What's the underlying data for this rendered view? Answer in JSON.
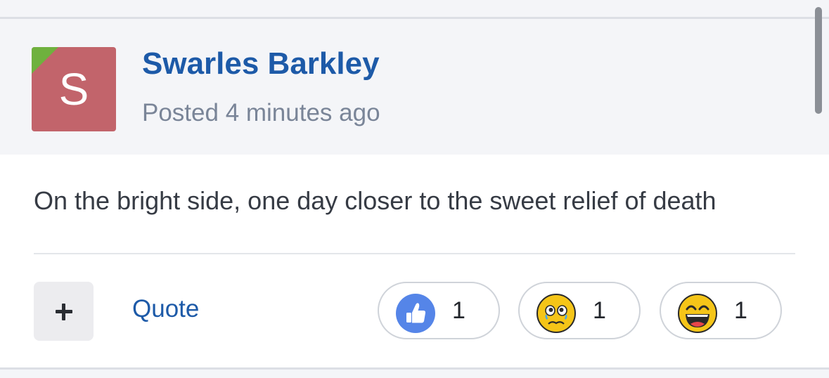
{
  "post": {
    "author_name": "Swarles Barkley",
    "avatar_letter": "S",
    "posted_time": "Posted 4 minutes ago",
    "body": "On the bright side, one day closer to the sweet relief of death"
  },
  "actions": {
    "add_icon": "plus-icon",
    "quote_label": "Quote"
  },
  "reactions": [
    {
      "icon": "thumbs-up-icon",
      "count": "1"
    },
    {
      "icon": "crying-face-icon",
      "count": "1"
    },
    {
      "icon": "laughing-face-icon",
      "count": "1"
    }
  ],
  "colors": {
    "author_link": "#1d5aa8",
    "avatar_bg": "#c2646b",
    "avatar_corner": "#6fb13e",
    "like_blue": "#5585e8",
    "emoji_yellow": "#f5c518"
  }
}
